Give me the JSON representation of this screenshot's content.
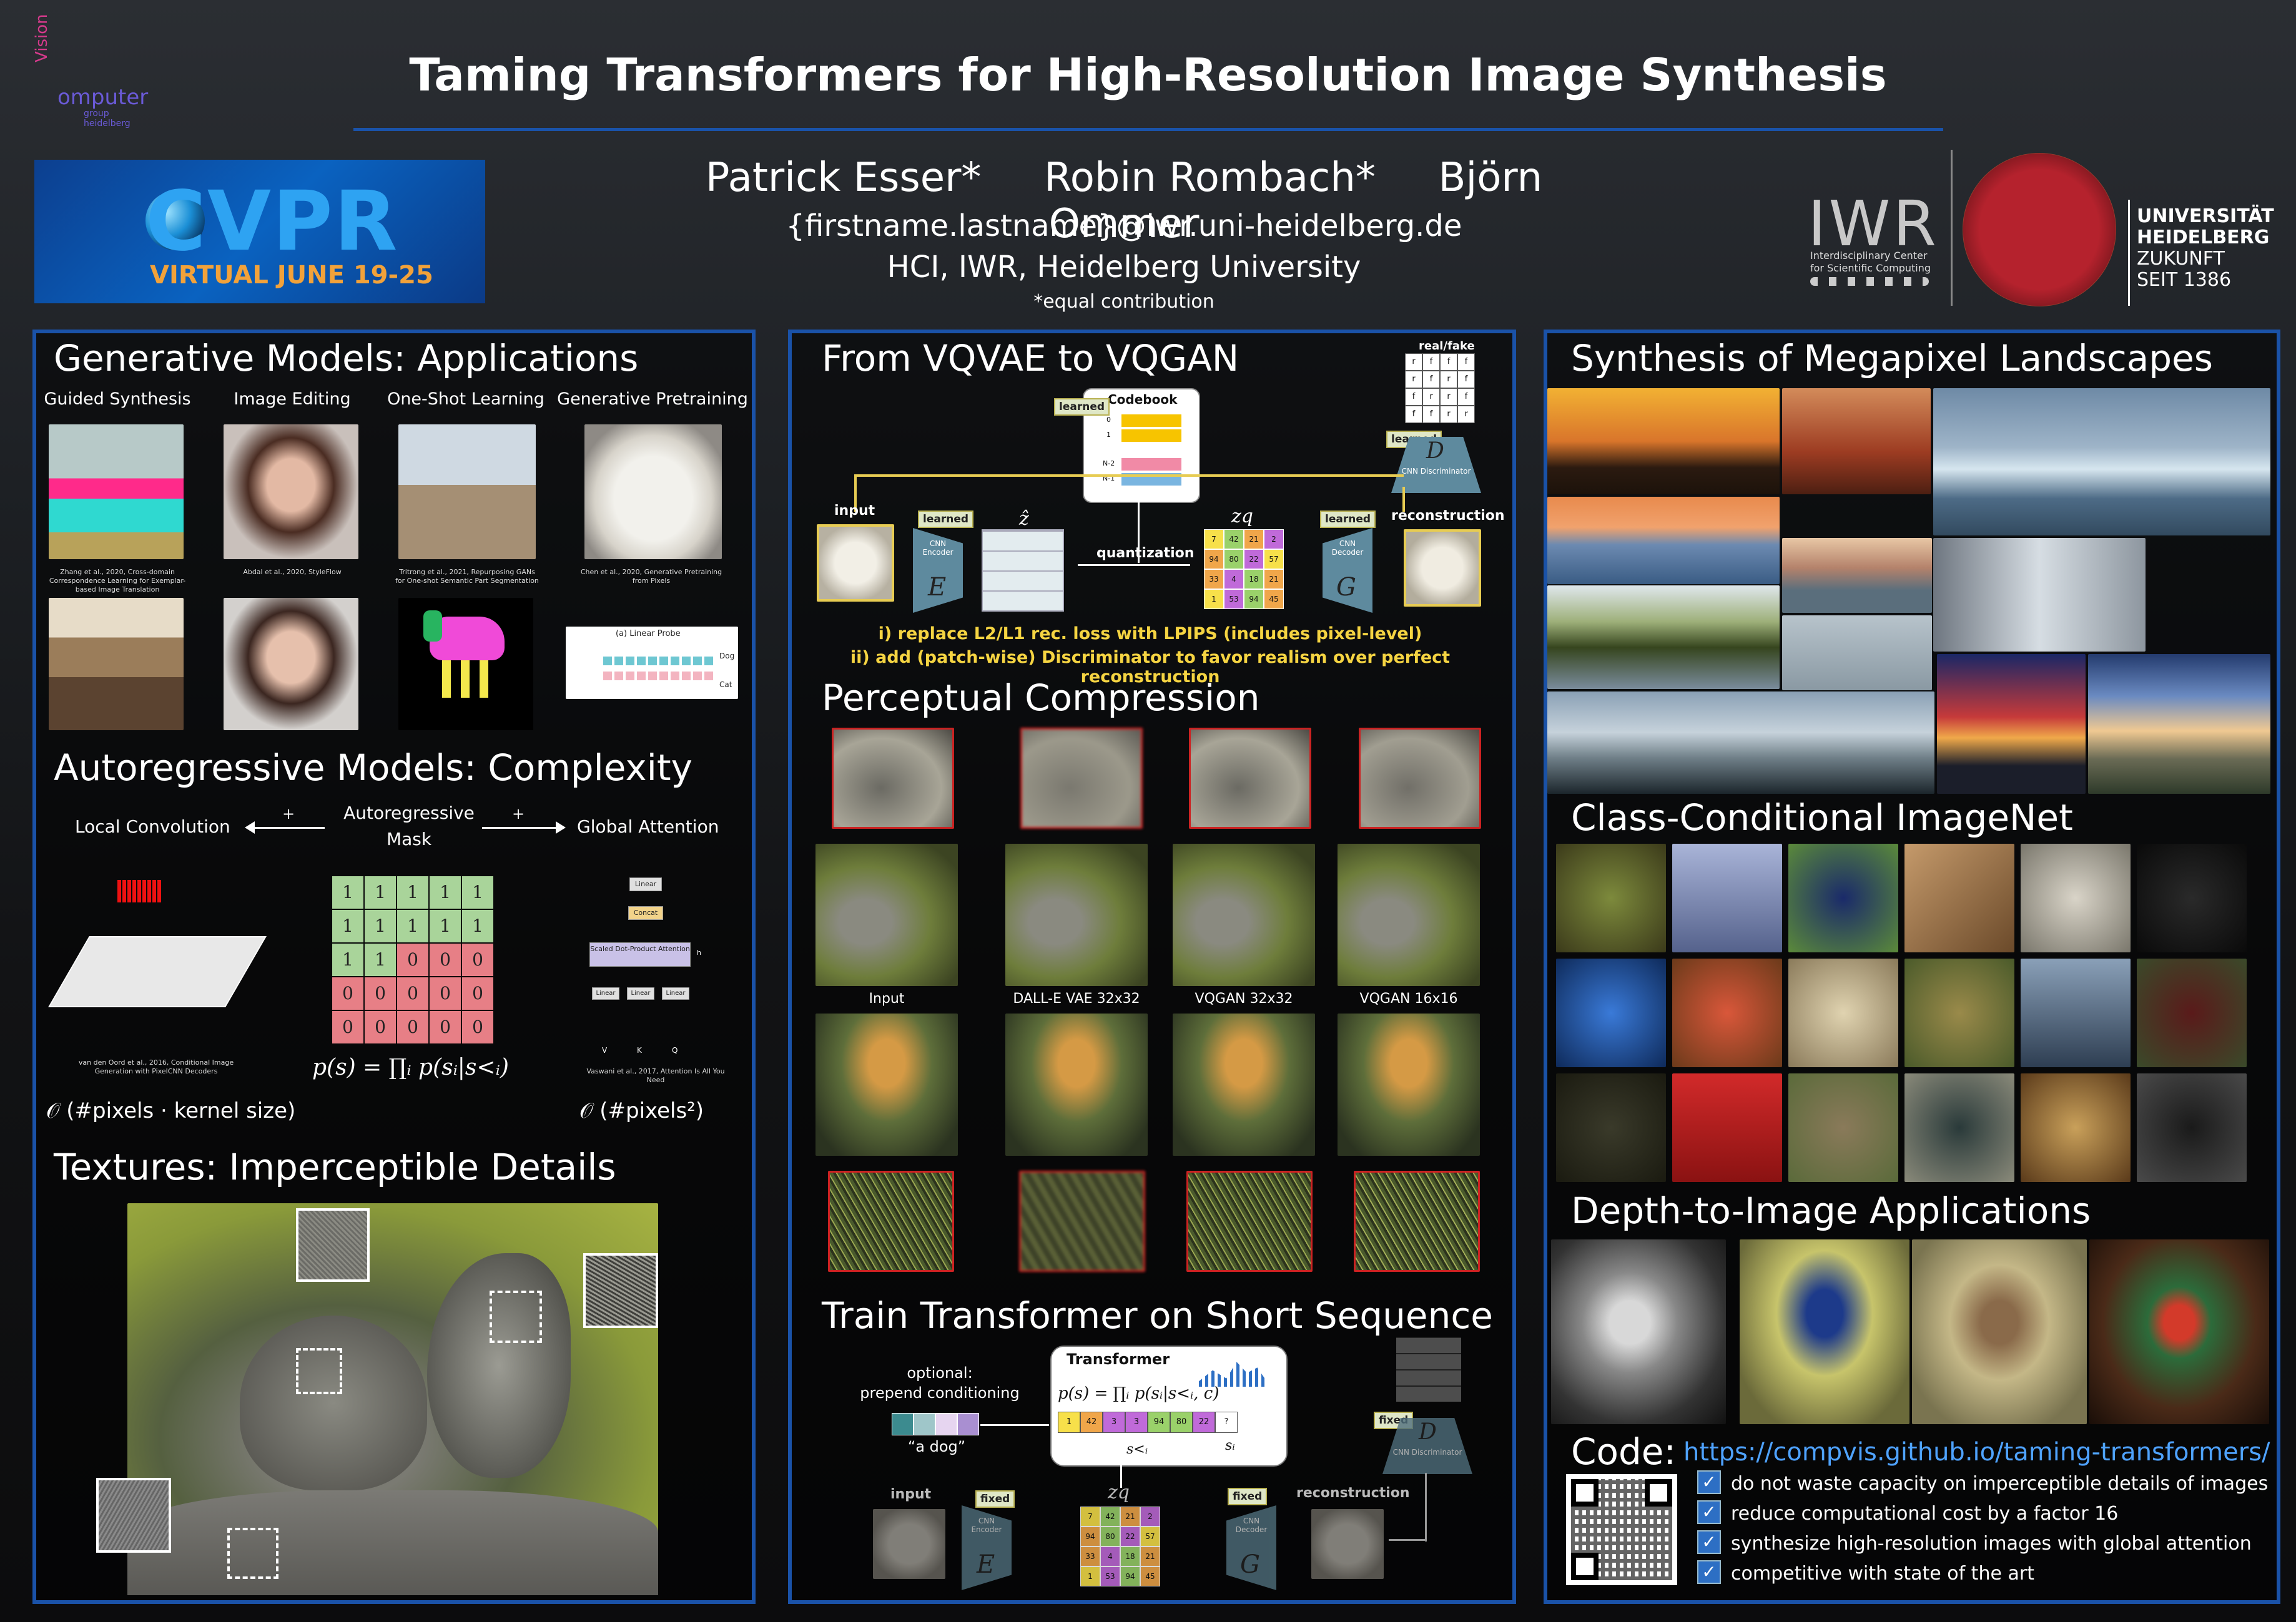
{
  "header": {
    "title": "Taming Transformers for High-Resolution Image Synthesis",
    "authors": [
      "Patrick Esser*",
      "Robin Rombach*",
      "Björn Ommer"
    ],
    "email": "{firstname.lastname}@iwr.uni-heidelberg.de",
    "affiliation": "HCI, IWR, Heidelberg University",
    "note": "*equal contribution",
    "cv_logo": {
      "v": "Vision",
      "c": "omputer",
      "sub": "group heidelberg"
    },
    "cvpr": {
      "main": "CVPR",
      "sub": "VIRTUAL JUNE 19-25"
    },
    "iwr": {
      "name": "IWR",
      "sub1": "Interdisciplinary Center",
      "sub2": "for Scientific Computing"
    },
    "uni": {
      "l1": "UNIVERSITÄT",
      "l2": "HEIDELBERG",
      "l3": "ZUKUNFT",
      "l4": "SEIT 1386"
    }
  },
  "applications": {
    "title": "Generative Models: Applications",
    "columns": [
      "Guided Synthesis",
      "Image Editing",
      "One-Shot Learning",
      "Generative Pretraining"
    ],
    "refs": [
      "Zhang et al., 2020, Cross-domain Correspondence Learning for Exemplar-based Image Translation",
      "Abdal et al., 2020, StyleFlow",
      "Tritrong et al., 2021, Repurposing GANs for One-shot Semantic Part Segmentation",
      "Chen et al., 2020, Generative Pretraining from Pixels"
    ],
    "probe": {
      "title": "(a) Linear Probe",
      "dog": "Dog",
      "cat": "Cat"
    }
  },
  "autoregressive": {
    "title": "Autoregressive Models: Complexity",
    "local": "Local Convolution",
    "mask": "Autoregressive Mask",
    "global": "Global Attention",
    "plus": "+",
    "mask_grid": [
      [
        1,
        1,
        1,
        1,
        1
      ],
      [
        1,
        1,
        1,
        1,
        1
      ],
      [
        1,
        1,
        0,
        0,
        0
      ],
      [
        0,
        0,
        0,
        0,
        0
      ],
      [
        0,
        0,
        0,
        0,
        0
      ]
    ],
    "formula": "p(s) = ∏ᵢ p(sᵢ|s<ᵢ)",
    "ref_left": "van den Oord et al., 2016, Conditional Image Generation with PixelCNN Decoders",
    "ref_right": "Vaswani et al., 2017, Attention Is All You Need",
    "complexity_left": "𝒪 (#pixels · kernel size)",
    "complexity_right": "𝒪 (#pixels²)",
    "attn_labels": {
      "linear": "Linear",
      "concat": "Concat",
      "sdpa": "Scaled Dot-Product Attention",
      "v": "V",
      "k": "K",
      "q": "Q",
      "h": "h"
    }
  },
  "textures": {
    "title": "Textures: Imperceptible Details"
  },
  "vqgan": {
    "title": "From VQVAE to VQGAN",
    "learned": "learned",
    "codebook": "Codebook",
    "cb_rows": [
      "0",
      "1",
      "N-2",
      "N-1"
    ],
    "input": "input",
    "encoder": "CNN Encoder",
    "enc_sym": "E",
    "z_hat": "ẑ",
    "quantization": "quantization",
    "zq": "zq",
    "zq_vals": [
      "7",
      "42",
      "21",
      "2",
      "94",
      "80",
      "22",
      "57",
      "33",
      "4",
      "18",
      "21",
      "1",
      "53",
      "94",
      "45"
    ],
    "decoder": "CNN Decoder",
    "dec_sym": "G",
    "reconstruction": "reconstruction",
    "realfake": "real/fake",
    "disc": "CNN Discriminator",
    "disc_sym": "D",
    "rf_grid": [
      "r",
      "f",
      "f",
      "f",
      "r",
      "f",
      "r",
      "f",
      "f",
      "r",
      "r",
      "f",
      "f",
      "f",
      "r",
      "r"
    ],
    "note1": "i) replace L2/L1 rec. loss with LPIPS (includes pixel-level)",
    "note2": "ii) add (patch-wise) Discriminator to favor realism over perfect reconstruction"
  },
  "perceptual": {
    "title": "Perceptual Compression",
    "labels": [
      "Input",
      "DALL-E VAE 32x32",
      "VQGAN 32x32",
      "VQGAN 16x16"
    ]
  },
  "train": {
    "title": "Train Transformer on Short Sequence",
    "optional": "optional:",
    "prepend": "prepend conditioning",
    "a_dog": "“a dog”",
    "transformer": "Transformer",
    "formula": "p(s) = ∏ᵢ p(sᵢ|s<ᵢ, c)",
    "seq": [
      "1",
      "42",
      "3",
      "3",
      "94",
      "80",
      "22",
      "?"
    ],
    "s_lt_i": "s<ᵢ",
    "s_i": "sᵢ",
    "fixed": "fixed",
    "input": "input",
    "reconstruction": "reconstruction",
    "encoder": "CNN Encoder",
    "decoder": "CNN Decoder",
    "disc": "CNN Discriminator",
    "zq": "zq"
  },
  "landscapes": {
    "title": "Synthesis of Megapixel Landscapes"
  },
  "imagenet": {
    "title": "Class-Conditional ImageNet"
  },
  "depth": {
    "title": "Depth-to-Image Applications"
  },
  "code": {
    "label": "Code:",
    "url": "https://compvis.github.io/taming-transformers/",
    "bullets": [
      "do not waste capacity on imperceptible details of images",
      "reduce computational cost by a factor 16",
      "synthesize high-resolution images with global attention",
      "competitive with state of the art"
    ],
    "check": "✓"
  },
  "colors": {
    "panel_border": "#1a52a8",
    "note_yellow": "#f5d442",
    "mask_green": "#a9d49a",
    "mask_red": "#e77f86"
  }
}
